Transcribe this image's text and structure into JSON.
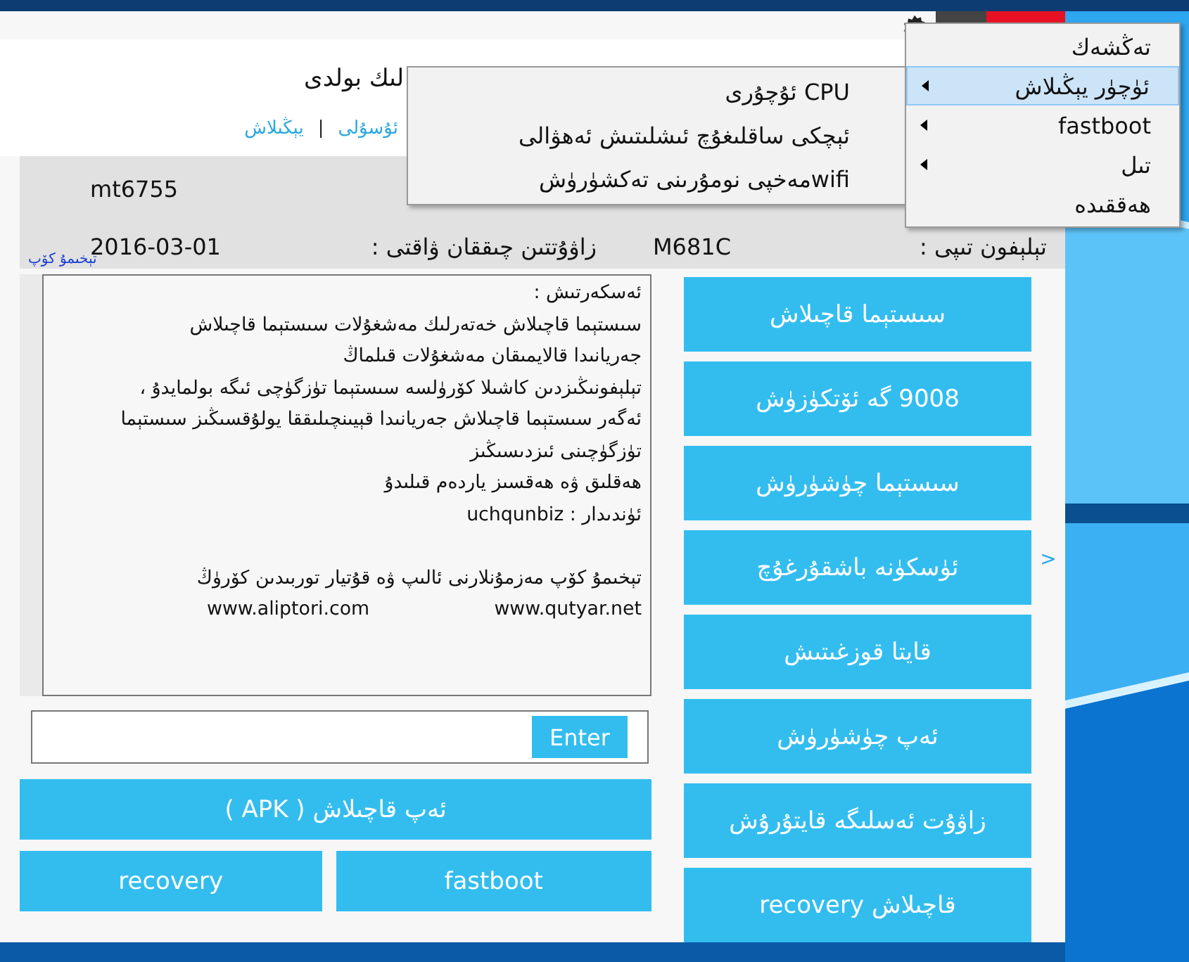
{
  "title_fragment": "لىك بولدى",
  "links": [
    {
      "label": "ئۇسۇلى"
    },
    {
      "label": "يېڭىلاش"
    }
  ],
  "link_separator": "|",
  "chip_value": "mt6755",
  "info_rows": [
    {
      "label_a": "تېلېفون تىپى :",
      "value_a": "M681C",
      "label_b": "زاۋۇتتىن چىققان ۋاقتى :",
      "value_b": "2016-03-01"
    }
  ],
  "more_link": "تېخىمۇ كۆپ",
  "notes": [
    "ئەسكەرتىش :",
    "سىستېما  قاچىلاش خەتەرلىك مەشغۇلات  سىستېما قاچىلاش",
    "جەريانىدا قالايمىقان مەشغۇلات قىلماڭ",
    "تېلېفونىڭىزدىن كاشىلا كۆرۈلسە سىستېما تۈزگۈچى ئىگە بولمايدۇ ،",
    "ئەگەر سىستېما قاچىلاش جەريانىدا  قېيىنچىلىققا يولۇقسىڭىز سىستېما",
    "تۈزگۈچىنى ئىزدىسىڭىز",
    "ھەقلىق ۋە ھەقسىز ياردەم قىلىدۇ",
    "ئۈندىدار : uchqunbiz"
  ],
  "footer_note": "تېخىمۇ كۆپ مەزمۇنلارنى  ئالىپ  ۋە قۇتيار  توربىدىن كۆرۈڭ",
  "sites": [
    "www.qutyar.net",
    "www.aliptori.com"
  ],
  "side_buttons": [
    "سىستېما قاچىلاش",
    "9008 گە  ئۆتكۈزۈش",
    "سىستېما چۈشۈرۈش",
    "ئۈسكۈنە باشقۇرغۇچ",
    "قايتا قوزغىتىش",
    "ئەپ چۈشۈرۈش",
    "زاۋۇت ئەسلىگە قايتۇرۇش"
  ],
  "command_button": "Enter",
  "apk_button": "ئەپ قاچىلاش  ( APK )",
  "bottom_buttons": [
    "recovery",
    "fastboot",
    "قاچىلاش  recovery"
  ],
  "side_arrow": ">",
  "menu": [
    {
      "label": "تەڭشەك",
      "selected": false,
      "submenu": false
    },
    {
      "label": "ئۈچۈر يېڭىلاش",
      "selected": true,
      "submenu": true
    },
    {
      "label": "fastboot",
      "selected": false,
      "submenu": true
    },
    {
      "label": "تىل",
      "selected": false,
      "submenu": true
    },
    {
      "label": "ھەققىدە",
      "selected": false,
      "submenu": false
    }
  ],
  "submenu": [
    {
      "label": "CPU ئۇچۇرى"
    },
    {
      "label": "ئېچكى ساقلىغۇچ ئىشلىتىش ئەھۋالى"
    },
    {
      "label": "wifiمەخپى نومۇرىنى تەكشۈرۈش"
    }
  ]
}
